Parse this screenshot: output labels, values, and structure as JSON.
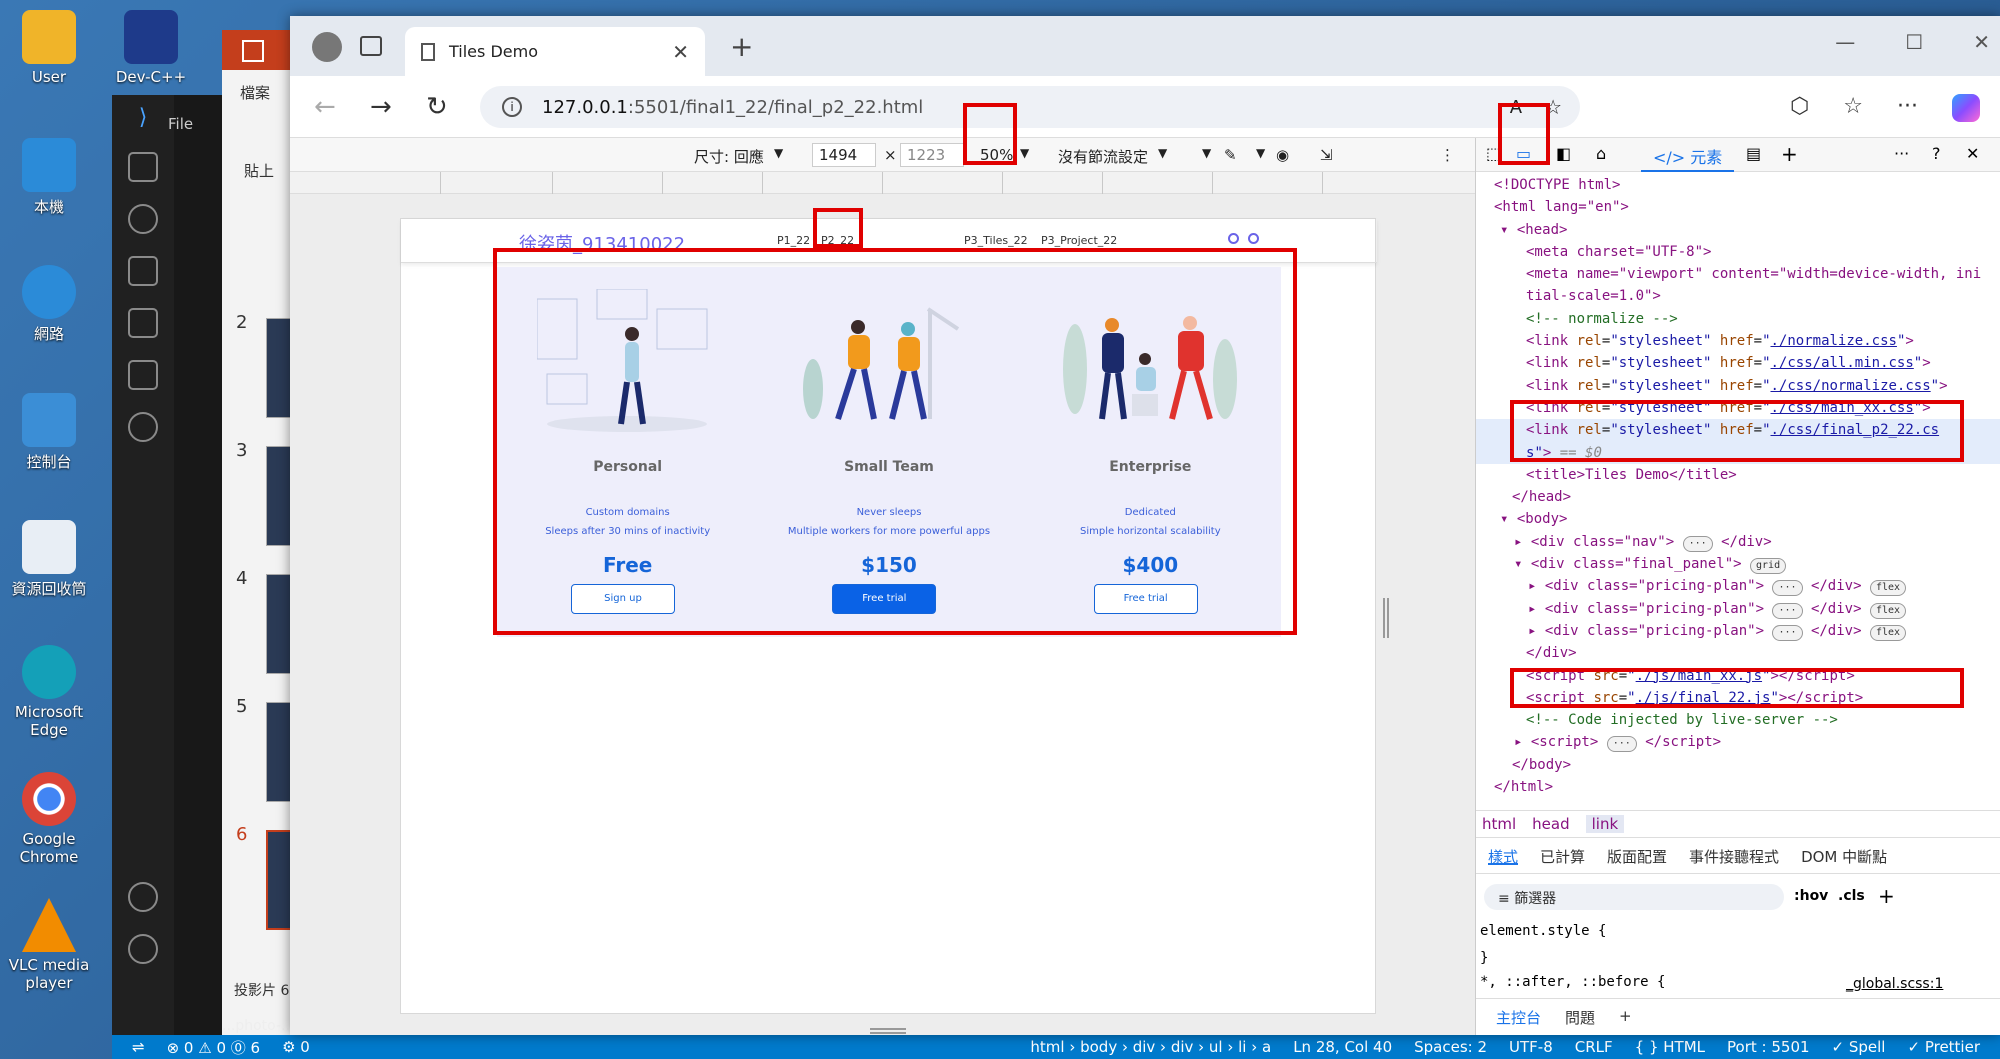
{
  "desktop": {
    "icons": [
      {
        "label": "User",
        "color": "#f0b429"
      },
      {
        "label": "Dev-C++",
        "color": "#1e3a8a"
      },
      {
        "label": "本機",
        "color": "#2b8bd8"
      },
      {
        "label": "網路",
        "color": "#2b8bd8"
      },
      {
        "label": "控制台",
        "color": "#3b8ed6"
      },
      {
        "label": "資源回收筒",
        "color": "#e8eef5"
      },
      {
        "label": "Microsoft Edge",
        "color": "#14a0b8"
      },
      {
        "label": "Google Chrome",
        "color": "#db4437"
      },
      {
        "label": "VLC media player",
        "color": "#f28c00"
      }
    ]
  },
  "bg_apps": {
    "vscode_menu": "File",
    "ppt_menu": "檔案",
    "ppt_paste": "貼上",
    "ppt_slide_numbers": [
      "2",
      "3",
      "4",
      "5",
      "6"
    ],
    "ppt_footer": "投影片 6",
    "ppt_file": "...photo-..."
  },
  "statusbar": {
    "left": [
      "⊗ 0 ⚠ 0 ⓪ 6",
      "⚙ 0"
    ],
    "right": [
      "html › body › div › div › ul › li › a",
      "Ln 28, Col 40",
      "Spaces: 2",
      "UTF-8",
      "CRLF",
      "{ } HTML",
      "Port : 5501",
      "✓ Spell",
      "✓ Prettier"
    ]
  },
  "browser": {
    "tab_title": "Tiles Demo",
    "url_host": "127.0.0.1",
    "url_path": ":5501/final1_22/final_p2_22.html"
  },
  "device_toolbar": {
    "dimensions_label": "尺寸: 回應",
    "width": "1494",
    "height": "1223",
    "zoom": "50%",
    "throttle": "沒有節流設定"
  },
  "page": {
    "author": "徐姿茵_913410022",
    "links": [
      "P1_22",
      "P2_22",
      "P3_Tiles_22",
      "P3_Project_22"
    ],
    "plans": [
      {
        "name": "Personal",
        "feature1": "Custom domains",
        "feature2": "Sleeps after 30 mins of inactivity",
        "price": "Free",
        "button": "Sign up",
        "primary": false
      },
      {
        "name": "Small Team",
        "feature1": "Never sleeps",
        "feature2": "Multiple workers for more powerful apps",
        "price": "$150",
        "button": "Free trial",
        "primary": true
      },
      {
        "name": "Enterprise",
        "feature1": "Dedicated",
        "feature2": "Simple horizontal scalability",
        "price": "$400",
        "button": "Free trial",
        "primary": false
      }
    ]
  },
  "devtools": {
    "elements_tab": "元素",
    "breadcrumbs": [
      "html",
      "head",
      "link"
    ],
    "style_tabs": [
      "樣式",
      "已計算",
      "版面配置",
      "事件接聽程式",
      "DOM 中斷點"
    ],
    "filter": "篩選器",
    "hov": ":hov",
    "cls": ".cls",
    "element_style": "element.style {",
    "close_brace": "}",
    "universal": "*, ::after, ::before {",
    "global_file": "_global.scss:1",
    "console_tabs": [
      "主控台",
      "問題"
    ]
  },
  "dom": {
    "doctype": "<!DOCTYPE html>",
    "html_open": "<html lang=\"en\">",
    "head": "▾ <head>",
    "meta_charset": "<meta charset=\"UTF-8\">",
    "meta_viewport_1": "<meta name=\"viewport\" content=\"width=device-width, ini",
    "meta_viewport_2": "tial-scale=1.0\">",
    "comment_normalize": "<!-- normalize -->",
    "link1": "./normalize.css",
    "link2": "./css/all.min.css",
    "link3": "./css/normalize.css",
    "link4": "./css/main_xx.css",
    "link5a": "./css/final_p2_22.cs",
    "link5b": "s",
    "eq": "== $0",
    "title_line": "<title>Tiles Demo</title>",
    "head_close": "</head>",
    "body": "▾ <body>",
    "div_nav": "▸ <div class=\"nav\">",
    "div_panel": "▾ <div class=\"final_panel\">",
    "grid": "grid",
    "pricing": "▸ <div class=\"pricing-plan\">",
    "flex": "flex",
    "div_close": "</div>",
    "script_main": "./js/main_xx.js",
    "script_final": "./js/final_22.js",
    "comment_live": "<!-- Code injected by live-server -->",
    "script_live": "▸ <script>",
    "body_close": "</body>",
    "html_close": "</html>"
  }
}
